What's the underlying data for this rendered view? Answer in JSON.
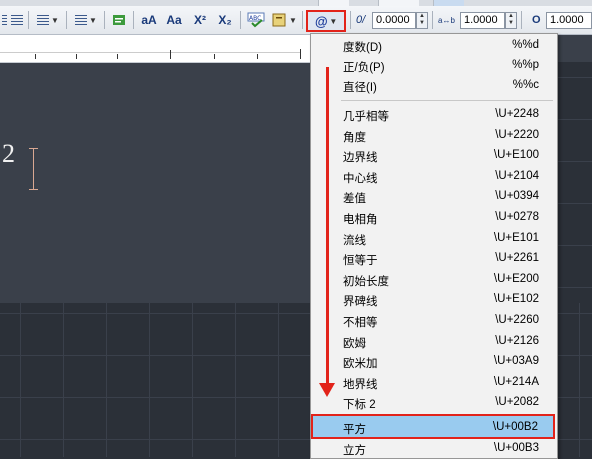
{
  "toolbar": {
    "symbol_button_label": "@",
    "obliquing_label": "0/",
    "obliquing_value": "0.0000",
    "tracking_label": "a↔b",
    "tracking_value": "1.0000",
    "width_label": "O",
    "width_value": "1.0000",
    "stack_label": "b/a",
    "superscript_label": "X²",
    "subscript_label": "X₂",
    "uppercase_label": "aA",
    "lowercase_label": "Aa"
  },
  "editor": {
    "text": "2"
  },
  "symbol_menu": {
    "basic_items": [
      {
        "name": "度数(D)",
        "code": "%%d"
      },
      {
        "name": "正/负(P)",
        "code": "%%p"
      },
      {
        "name": "直径(I)",
        "code": "%%c"
      }
    ],
    "unicode_items": [
      {
        "name": "几乎相等",
        "code": "\\U+2248"
      },
      {
        "name": "角度",
        "code": "\\U+2220"
      },
      {
        "name": "边界线",
        "code": "\\U+E100"
      },
      {
        "name": "中心线",
        "code": "\\U+2104"
      },
      {
        "name": "差值",
        "code": "\\U+0394"
      },
      {
        "name": "电相角",
        "code": "\\U+0278"
      },
      {
        "name": "流线",
        "code": "\\U+E101"
      },
      {
        "name": "恒等于",
        "code": "\\U+2261"
      },
      {
        "name": "初始长度",
        "code": "\\U+E200"
      },
      {
        "name": "界碑线",
        "code": "\\U+E102"
      },
      {
        "name": "不相等",
        "code": "\\U+2260"
      },
      {
        "name": "欧姆",
        "code": "\\U+2126"
      },
      {
        "name": "欧米加",
        "code": "\\U+03A9"
      },
      {
        "name": "地界线",
        "code": "\\U+214A"
      },
      {
        "name": "下标 2",
        "code": "\\U+2082"
      }
    ],
    "selected_item": {
      "name": "平方",
      "code": "\\U+00B2"
    },
    "after_items": [
      {
        "name": "立方",
        "code": "\\U+00B3"
      }
    ]
  },
  "colors": {
    "highlight_border": "#e2231a",
    "selected_background": "#99cbef",
    "canvas_background": "#2b3038"
  }
}
